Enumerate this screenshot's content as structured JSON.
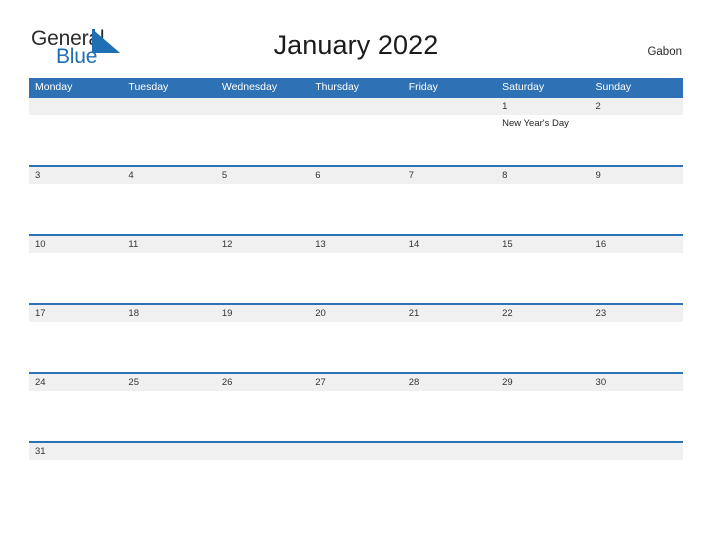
{
  "brand": {
    "name_part1": "General",
    "name_part2": "Blue",
    "triangle_icon": "blue-triangle-logo-mark",
    "color_dark": "#2b2b2b",
    "color_blue": "#1f6fb5"
  },
  "header": {
    "title": "January 2022",
    "country": "Gabon"
  },
  "colors": {
    "header_band": "#2e72b5",
    "date_band": "#f0f0f0",
    "row_rule": "#2e72b5",
    "page_background": "#ffffff",
    "text": "#333333"
  },
  "calendar": {
    "month": "January",
    "year": "2022",
    "first_day_of_week": "Monday",
    "weekdays": [
      "Monday",
      "Tuesday",
      "Wednesday",
      "Thursday",
      "Friday",
      "Saturday",
      "Sunday"
    ],
    "weeks": [
      {
        "days": [
          {
            "num": "",
            "event": ""
          },
          {
            "num": "",
            "event": ""
          },
          {
            "num": "",
            "event": ""
          },
          {
            "num": "",
            "event": ""
          },
          {
            "num": "",
            "event": ""
          },
          {
            "num": "1",
            "event": "New Year's Day"
          },
          {
            "num": "2",
            "event": ""
          }
        ]
      },
      {
        "days": [
          {
            "num": "3",
            "event": ""
          },
          {
            "num": "4",
            "event": ""
          },
          {
            "num": "5",
            "event": ""
          },
          {
            "num": "6",
            "event": ""
          },
          {
            "num": "7",
            "event": ""
          },
          {
            "num": "8",
            "event": ""
          },
          {
            "num": "9",
            "event": ""
          }
        ]
      },
      {
        "days": [
          {
            "num": "10",
            "event": ""
          },
          {
            "num": "11",
            "event": ""
          },
          {
            "num": "12",
            "event": ""
          },
          {
            "num": "13",
            "event": ""
          },
          {
            "num": "14",
            "event": ""
          },
          {
            "num": "15",
            "event": ""
          },
          {
            "num": "16",
            "event": ""
          }
        ]
      },
      {
        "days": [
          {
            "num": "17",
            "event": ""
          },
          {
            "num": "18",
            "event": ""
          },
          {
            "num": "19",
            "event": ""
          },
          {
            "num": "20",
            "event": ""
          },
          {
            "num": "21",
            "event": ""
          },
          {
            "num": "22",
            "event": ""
          },
          {
            "num": "23",
            "event": ""
          }
        ]
      },
      {
        "days": [
          {
            "num": "24",
            "event": ""
          },
          {
            "num": "25",
            "event": ""
          },
          {
            "num": "26",
            "event": ""
          },
          {
            "num": "27",
            "event": ""
          },
          {
            "num": "28",
            "event": ""
          },
          {
            "num": "29",
            "event": ""
          },
          {
            "num": "30",
            "event": ""
          }
        ]
      },
      {
        "days": [
          {
            "num": "31",
            "event": ""
          },
          {
            "num": "",
            "event": ""
          },
          {
            "num": "",
            "event": ""
          },
          {
            "num": "",
            "event": ""
          },
          {
            "num": "",
            "event": ""
          },
          {
            "num": "",
            "event": ""
          },
          {
            "num": "",
            "event": ""
          }
        ]
      }
    ]
  }
}
